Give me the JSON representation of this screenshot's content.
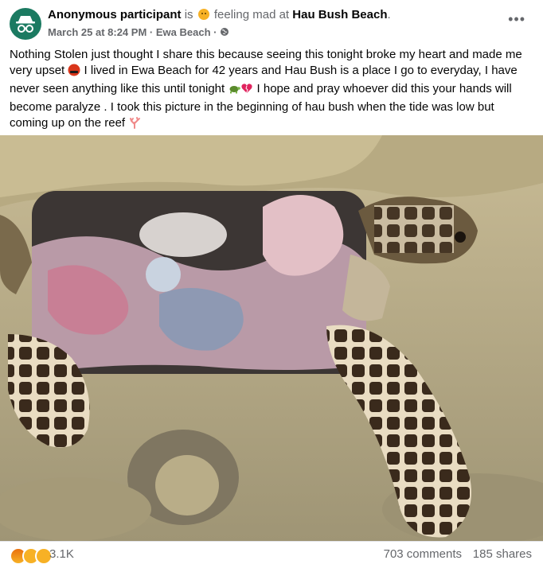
{
  "header": {
    "author": "Anonymous participant",
    "is_text": "is",
    "feeling_text": "feeling mad at",
    "place": "Hau Bush Beach",
    "end_punct": ".",
    "timestamp": "March 25 at 8:24 PM",
    "location": "Ewa Beach",
    "separator": "·",
    "more_label": "•••"
  },
  "post": {
    "text_part1": "Nothing Stolen just thought I share this because seeing this tonight broke my heart and made me very upset",
    "text_part2": "I lived in Ewa Beach for 42 years and Hau Bush is a place I go to everyday, I have never seen anything like this until tonight",
    "text_part3": "I hope and pray whoever did this your hands will become paralyze . I took this picture in the beginning of hau bush when the tide was low but coming up on the reef"
  },
  "footer": {
    "reaction_count": "3.1K",
    "comments": "703 comments",
    "shares": "185 shares"
  },
  "colors": {
    "avatar": "#1b7a61",
    "muted_text": "#65676b",
    "divider": "#e4e6eb"
  }
}
